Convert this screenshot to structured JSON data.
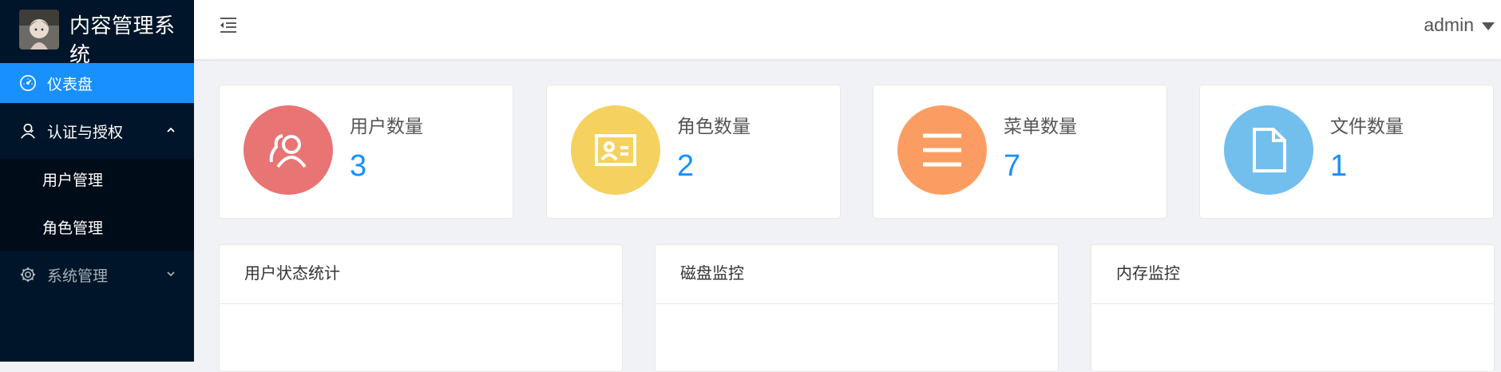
{
  "app": {
    "title": "内容管理系统"
  },
  "sidebar": {
    "items": [
      {
        "label": "仪表盘",
        "icon": "dashboard-icon",
        "active": true
      },
      {
        "label": "认证与授权",
        "icon": "user-auth-icon",
        "open": true
      },
      {
        "label": "系统管理",
        "icon": "gear-icon",
        "open": false
      }
    ],
    "submenu": [
      {
        "label": "用户管理"
      },
      {
        "label": "角色管理"
      }
    ]
  },
  "header": {
    "user": "admin"
  },
  "stats": [
    {
      "label": "用户数量",
      "value": "3",
      "color": "#e87474",
      "icon": "users-icon"
    },
    {
      "label": "角色数量",
      "value": "2",
      "color": "#f5d15f",
      "icon": "id-card-icon"
    },
    {
      "label": "菜单数量",
      "value": "7",
      "color": "#fb9d63",
      "icon": "menu-icon"
    },
    {
      "label": "文件数量",
      "value": "1",
      "color": "#72bfee",
      "icon": "file-icon"
    }
  ],
  "panels": [
    {
      "title": "用户状态统计"
    },
    {
      "title": "磁盘监控"
    },
    {
      "title": "内存监控"
    }
  ],
  "colors": {
    "sidebar_bg": "#001529",
    "active": "#1890ff",
    "accent_text": "#1890ff"
  }
}
